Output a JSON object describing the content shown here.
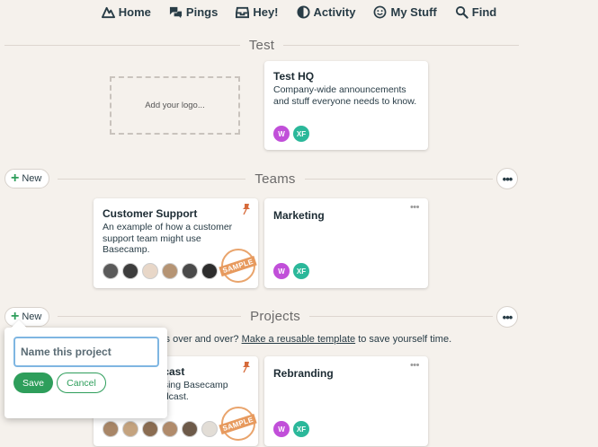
{
  "nav": {
    "home": "Home",
    "pings": "Pings",
    "hey": "Hey!",
    "activity": "Activity",
    "mystuff": "My Stuff",
    "find": "Find"
  },
  "company": {
    "section_title": "Test",
    "logo_placeholder": "Add your logo...",
    "hq_card": {
      "title": "Test HQ",
      "description": "Company-wide announcements and stuff everyone needs to know.",
      "avatars": [
        {
          "initials": "W",
          "color": "#c14fd9"
        },
        {
          "initials": "XF",
          "color": "#2bb89a"
        }
      ]
    }
  },
  "teams": {
    "section_title": "Teams",
    "new_label": "New",
    "cards": [
      {
        "title": "Customer Support",
        "description": "An example of how a customer support team might use Basecamp.",
        "badge": "SAMPLE"
      },
      {
        "title": "Marketing",
        "description": "",
        "avatars": [
          {
            "initials": "W",
            "color": "#c14fd9"
          },
          {
            "initials": "XF",
            "color": "#2bb89a"
          }
        ]
      }
    ]
  },
  "projects": {
    "section_title": "Projects",
    "new_label": "New",
    "tagline_prefix": "cts over and over?",
    "tagline_link": "Make a reusable template",
    "tagline_suffix": "to save yourself time.",
    "cards": [
      {
        "title": "dcast",
        "description": "using Basecamp odcast.",
        "badge": "SAMPLE"
      },
      {
        "title": "Rebranding",
        "avatars": [
          {
            "initials": "W",
            "color": "#c14fd9"
          },
          {
            "initials": "XF",
            "color": "#2bb89a"
          }
        ]
      }
    ]
  },
  "new_project_popup": {
    "placeholder": "Name this project",
    "save_label": "Save",
    "cancel_label": "Cancel"
  },
  "colors": {
    "background": "#f5f1ec",
    "accent_green": "#2e9e5b",
    "sample_orange": "#e79a5e"
  }
}
